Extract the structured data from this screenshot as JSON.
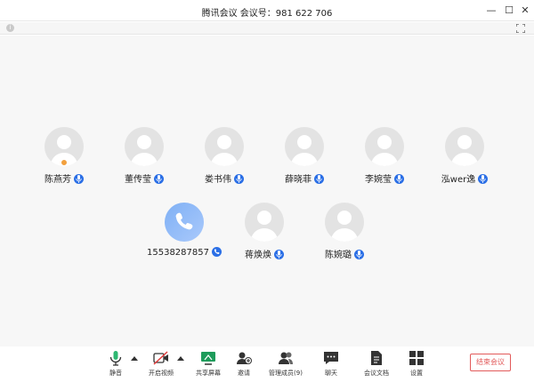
{
  "window": {
    "title": "腾讯会议 会议号：981 622 706",
    "minimize_label": "—",
    "maximize_label": "☐",
    "close_label": "✕",
    "info_label": "i"
  },
  "participants": [
    {
      "name": "陈燕芳",
      "icon": "person-avatar",
      "host": true
    },
    {
      "name": "董传莹",
      "icon": "person-avatar"
    },
    {
      "name": "娄书伟",
      "icon": "person-avatar"
    },
    {
      "name": "薛晓菲",
      "icon": "person-avatar"
    },
    {
      "name": "李婉莹",
      "icon": "person-avatar"
    },
    {
      "name": "泓wer逸",
      "icon": "person-avatar"
    },
    {
      "name": "15538287857",
      "icon": "phone-avatar",
      "phone": true
    },
    {
      "name": "蒋焕焕",
      "icon": "person-avatar"
    },
    {
      "name": "陈婉璐",
      "icon": "person-avatar"
    }
  ],
  "toolbar": {
    "mute": "静音",
    "video": "开启视频",
    "share": "共享屏幕",
    "invite": "邀请",
    "members": "管理成员(9)",
    "chat": "聊天",
    "docs": "会议文档",
    "settings": "设置",
    "end": "结束会议"
  },
  "colors": {
    "accent": "#2b6fe6",
    "end_red": "#e25a5a",
    "host_badge": "#f2a03d",
    "avatar_bg": "#e3e3e3"
  }
}
